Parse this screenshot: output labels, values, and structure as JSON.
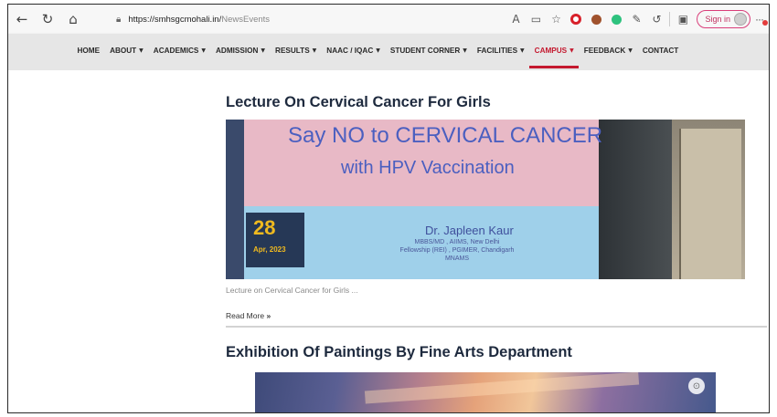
{
  "browser": {
    "url_host": "https://smhsgcmohali.in/",
    "url_path": "NewsEvents",
    "signin_label": "Sign in"
  },
  "nav": {
    "items": [
      {
        "label": "HOME",
        "caret": false
      },
      {
        "label": "ABOUT",
        "caret": true
      },
      {
        "label": "ACADEMICS",
        "caret": true
      },
      {
        "label": "ADMISSION",
        "caret": true
      },
      {
        "label": "RESULTS",
        "caret": true
      },
      {
        "label": "NAAC / IQAC",
        "caret": true
      },
      {
        "label": "STUDENT CORNER",
        "caret": true
      },
      {
        "label": "FACILITIES",
        "caret": true
      },
      {
        "label": "CAMPUS",
        "caret": true,
        "active": true
      },
      {
        "label": "FEEDBACK",
        "caret": true
      },
      {
        "label": "CONTACT",
        "caret": false
      }
    ]
  },
  "articles": [
    {
      "title": "Lecture On Cervical Cancer For Girls",
      "banner": {
        "line1_a": "Say NO to ",
        "line1_b": "CERVICAL CANCER",
        "line2": "with HPV Vaccination",
        "doctor": "Dr. Japleen Kaur",
        "cred1": "MBBS/MD , AIIMS, New Delhi",
        "cred2": "Fellowship (REI) , PGIMER, Chandigarh",
        "cred3": "MNAMS"
      },
      "date_day": "28",
      "date_month": "Apr, 2023",
      "excerpt": "Lecture on Cervical Cancer for Girls ...",
      "read_more": "Read More",
      "read_more_arrow": "»"
    },
    {
      "title": "Exhibition Of Paintings By Fine Arts Department"
    }
  ],
  "colors": {
    "accent": "#c4192f",
    "title": "#1e2a3e",
    "date_bg": "#20304f",
    "date_fg": "#f5b915"
  }
}
